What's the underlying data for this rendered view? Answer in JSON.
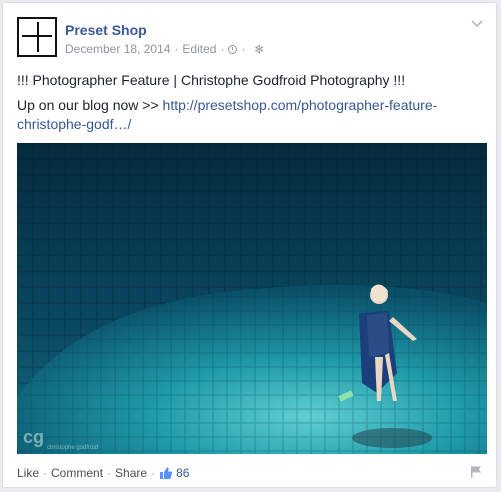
{
  "post": {
    "page_name": "Preset Shop",
    "date": "December 18, 2014",
    "edited_label": "Edited",
    "separator": "·",
    "headline": "!!! Photographer Feature | Christophe Godfroid Photography !!!",
    "body_prefix": "Up on our blog now >> ",
    "link_text": "http://presetshop.com/photographer-feature-christophe-godf…/",
    "photo": {
      "watermark": "cg",
      "watermark_caption": "christophe godfroid"
    }
  },
  "actions": {
    "like_label": "Like",
    "comment_label": "Comment",
    "share_label": "Share",
    "like_count": "86"
  },
  "icons": {
    "avatar": "preset-shop-logo",
    "privacy": "clock-icon",
    "settings": "gear-icon",
    "menu": "chevron-down-icon",
    "likes": "thumbs-up-icon",
    "report": "flag-icon"
  },
  "colors": {
    "link": "#365899",
    "page_name": "#3b5998",
    "meta": "#90949c",
    "text": "#1d2129",
    "background": "#e9ebee"
  }
}
